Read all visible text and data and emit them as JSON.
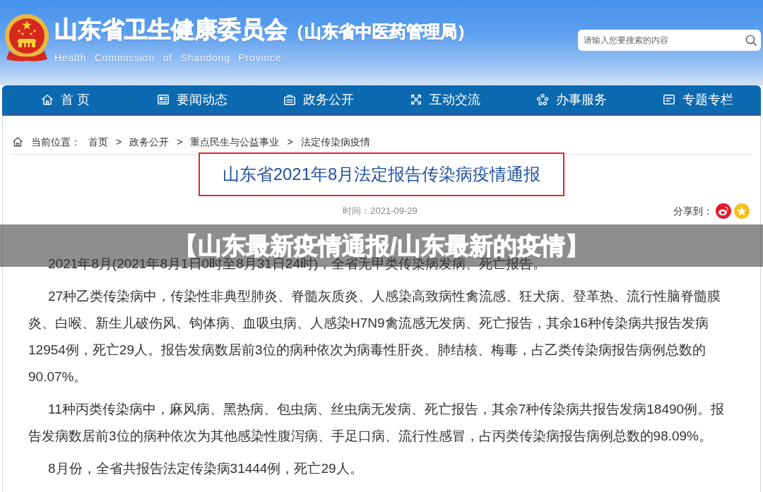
{
  "header": {
    "title": "山东省卫生健康委员会",
    "subtitle": "（山东省中医药管理局）",
    "english_name": "Health Commission of Shandong Province",
    "search": {
      "placeholder": "请输入您要搜索的内容"
    }
  },
  "nav": [
    {
      "label": "首 页",
      "selected": false
    },
    {
      "label": "要闻动态",
      "selected": false
    },
    {
      "label": "政务公开",
      "selected": false
    },
    {
      "label": "互动交流",
      "selected": false
    },
    {
      "label": "办事服务",
      "selected": false
    },
    {
      "label": "专题专栏",
      "selected": false
    }
  ],
  "breadcrumb": {
    "label": "当前位置：",
    "items": [
      {
        "text": "首页",
        "separator": ">"
      },
      {
        "text": "政务公开",
        "separator": ">"
      },
      {
        "text": "重点民生与公益事业",
        "separator": ">"
      },
      {
        "text": "法定传染病疫情"
      }
    ]
  },
  "article": {
    "title": "山东省2021年8月法定报告传染病疫情通报",
    "time": "时间：2021-09-29",
    "share_label": "分享到：",
    "paragraphs": [
      "2021年8月(2021年8月1日0时至8月31日24时)，全省无甲类传染病发病、死亡报告。",
      "27种乙类传染病中，传染性非典型肺炎、脊髓灰质炎、人感染高致病性禽流感、狂犬病、登革热、流行性脑脊髓膜炎、白喉、新生儿破伤风、钩体病、血吸虫病、人感染H7N9禽流感无发病、死亡报告，其余16种传染病共报告发病12954例，死亡29人。报告发病数居前3位的病种依次为病毒性肝炎、肺结核、梅毒，占乙类传染病报告病例总数的90.07%。",
      "11种丙类传染病中，麻风病、黑热病、包虫病、丝虫病无发病、死亡报告，其余7种传染病共报告发病18490例。报告发病数居前3位的病种依次为其他感染性腹泻病、手足口病、流行性感冒，占丙类传染病报告病例总数的98.09%。",
      "8月份，全省共报告法定传染病31444例，死亡29人。"
    ]
  },
  "overlay_caption": "【山东最新疫情通报/山东最新的疫情】"
}
